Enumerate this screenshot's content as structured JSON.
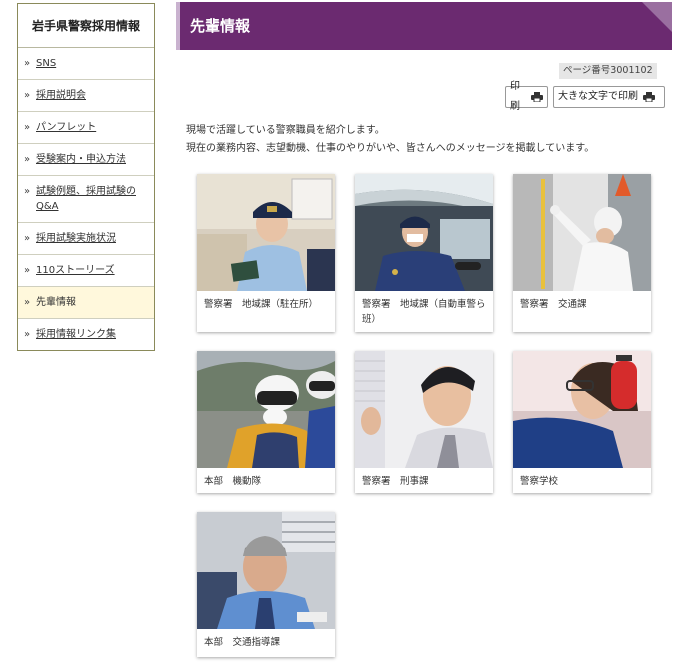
{
  "sidebar": {
    "title": "岩手県警察採用情報",
    "items": [
      {
        "label": "SNS"
      },
      {
        "label": "採用説明会"
      },
      {
        "label": "パンフレット"
      },
      {
        "label": "受験案内・申込方法"
      },
      {
        "label": "試験例題、採用試験のQ&A"
      },
      {
        "label": "採用試験実施状況"
      },
      {
        "label": "110ストーリーズ"
      },
      {
        "label": "先輩情報"
      },
      {
        "label": "採用情報リンク集"
      }
    ]
  },
  "header": {
    "title": "先輩情報"
  },
  "page_number": "ページ番号3001102",
  "buttons": {
    "print": "印刷",
    "print_large": "大きな文字で印刷"
  },
  "intro": {
    "line1": "現場で活躍している警察職員を紹介します。",
    "line2": "現在の業務内容、志望動機、仕事のやりがいや、皆さんへのメッセージを掲載しています。"
  },
  "cards": [
    {
      "caption": "警察署　地域課（駐在所）"
    },
    {
      "caption": "警察署　地域課（自動車警ら班）"
    },
    {
      "caption": "警察署　交通課"
    },
    {
      "caption": "本部　機動隊"
    },
    {
      "caption": "警察署　刑事課"
    },
    {
      "caption": "警察学校"
    },
    {
      "caption": "本部　交通指導課"
    }
  ],
  "colors": {
    "header_bg": "#6b2a70",
    "active_item_bg": "#fff8dc"
  },
  "icons": {
    "arrow": "double-chevron-right-icon",
    "print": "printer-icon"
  }
}
